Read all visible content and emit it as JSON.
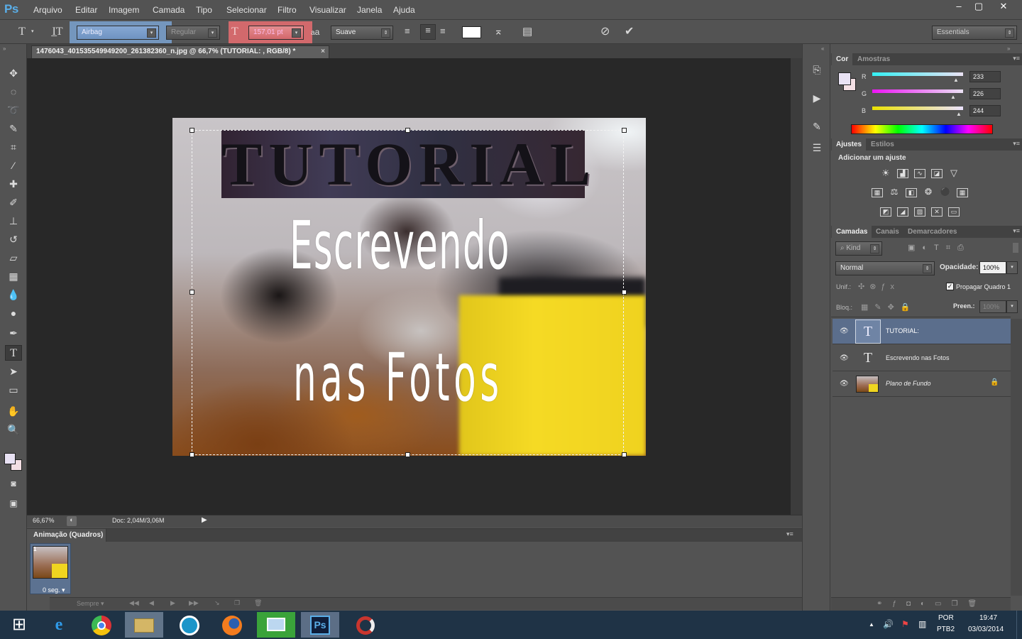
{
  "app": {
    "logo": "Ps"
  },
  "menu": [
    "Arquivo",
    "Editar",
    "Imagem",
    "Camada",
    "Tipo",
    "Selecionar",
    "Filtro",
    "Visualizar",
    "Janela",
    "Ajuda"
  ],
  "window_controls": {
    "minimize": "–",
    "restore": "▢",
    "close": "✕"
  },
  "options": {
    "font_family": "Airbag",
    "font_style": "Regular",
    "font_size": "157,01 pt",
    "aa_label": "a",
    "antialias": "Suave",
    "workspace": "Essentials"
  },
  "document": {
    "tab_title": "1476043_401535549949200_261382360_n.jpg @ 66,7% (TUTORIAL: , RGB/8) *",
    "zoom": "66,67%",
    "doc_info": "Doc: 2,04M/3,06M"
  },
  "canvas_text": {
    "title": "TUTORIAL",
    "line1": "Escrevendo",
    "line2": "nas Fotos"
  },
  "color_panel": {
    "tabs": [
      "Cor",
      "Amostras"
    ],
    "r_label": "R",
    "g_label": "G",
    "b_label": "B",
    "r": "233",
    "g": "226",
    "b": "244",
    "foreground": "#e9e2f4"
  },
  "adjustments_panel": {
    "tabs": [
      "Ajustes",
      "Estilos"
    ],
    "heading": "Adicionar um ajuste"
  },
  "layers_panel": {
    "tabs": [
      "Camadas",
      "Canais",
      "Demarcadores"
    ],
    "kind": "Kind",
    "blend_mode": "Normal",
    "opacity_label": "Opacidade:",
    "opacity": "100%",
    "unify_label": "Unif.:",
    "propagate_label": "Propagar Quadro 1",
    "lock_label": "Bloq.:",
    "fill_label": "Preen.:",
    "fill": "100%",
    "layers": [
      {
        "name": "TUTORIAL:",
        "type": "text",
        "selected": true
      },
      {
        "name": "Escrevendo  nas Fotos",
        "type": "text",
        "selected": false
      },
      {
        "name": "Plano de Fundo",
        "type": "image",
        "selected": false
      }
    ]
  },
  "animation_panel": {
    "title": "Animação (Quadros)",
    "frame_number": "1",
    "frame_delay": "0 seg.",
    "loop": "Sempre"
  },
  "taskbar": {
    "lang1": "POR",
    "lang2": "PTB2",
    "time": "19:47",
    "date": "03/03/2014"
  }
}
